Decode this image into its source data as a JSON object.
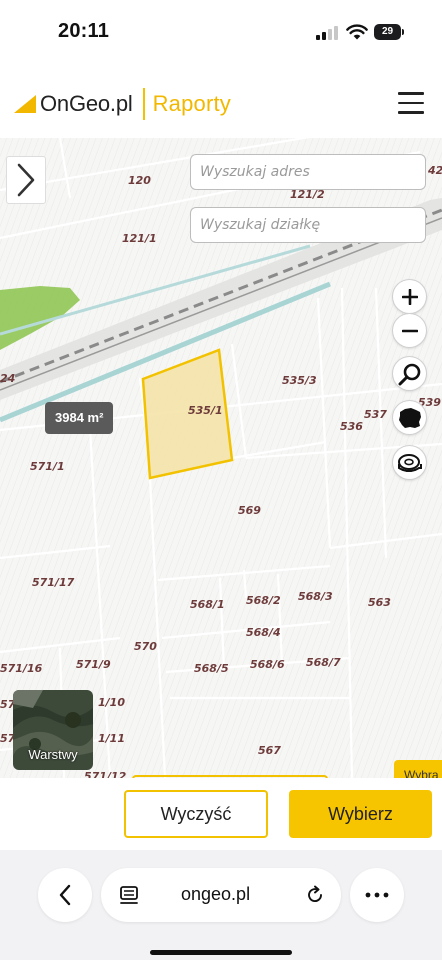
{
  "status_bar": {
    "time": "20:11",
    "battery_level": "29"
  },
  "header": {
    "logo_text": "OnGeo.pl",
    "logo_subtitle": "Raporty",
    "brand_color": "#f2c200",
    "menu_icon": "hamburger-menu-icon"
  },
  "map": {
    "search_address_placeholder": "Wyszukaj adres",
    "search_parcel_placeholder": "Wyszukaj działkę",
    "area_badge": "3984 m²",
    "layers_label": "Warstwy",
    "selected_tab_label": "Wybra",
    "selected_parcel_color": "#f2c200",
    "selected_parcel": "535/1",
    "tools": [
      "zoom-in-icon",
      "zoom-out-icon",
      "search-icon",
      "poland-map-icon",
      "measure-tape-icon"
    ],
    "parcel_labels": {
      "p120": "120",
      "p121_2": "121/2",
      "p42": "42",
      "p121_1": "121/1",
      "p24": "24",
      "p535_3": "535/3",
      "p535_1": "535/1",
      "p537": "537",
      "p539": "539",
      "p536": "536",
      "p571_1": "571/1",
      "p569": "569",
      "p571_17": "571/17",
      "p568_1": "568/1",
      "p568_2": "568/2",
      "p568_3": "568/3",
      "p563": "563",
      "p568_4": "568/4",
      "p570": "570",
      "p571_16": "571/16",
      "p571_9": "571/9",
      "p568_5": "568/5",
      "p568_6": "568/6",
      "p568_7": "568/7",
      "p57a": "57",
      "p1_10": "1/10",
      "p57b": "57",
      "p1_11": "1/11",
      "p567": "567",
      "p571_12": "571/12"
    }
  },
  "actions": {
    "clear_label": "Wyczyść",
    "select_label": "Wybierz"
  },
  "browser": {
    "url": "ongeo.pl"
  }
}
